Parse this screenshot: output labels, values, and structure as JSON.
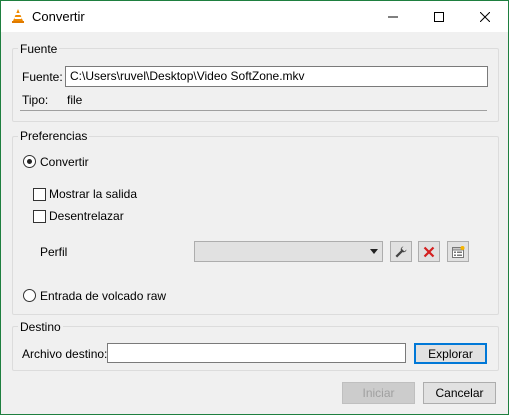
{
  "window": {
    "title": "Convertir"
  },
  "fuente": {
    "group_label": "Fuente",
    "fuente_label": "Fuente:",
    "fuente_value": "C:\\Users\\ruvel\\Desktop\\Video SoftZone.mkv",
    "tipo_label": "Tipo:",
    "tipo_value": "file"
  },
  "preferencias": {
    "group_label": "Preferencias",
    "convertir_label": "Convertir",
    "convertir_selected": true,
    "mostrar_salida_label": "Mostrar la salida",
    "mostrar_salida_checked": false,
    "desentrelazar_label": "Desentrelazar",
    "desentrelazar_checked": false,
    "perfil_label": "Perfil",
    "perfil_value": "",
    "raw_label": "Entrada de volcado raw",
    "raw_selected": false
  },
  "destino": {
    "group_label": "Destino",
    "archivo_label": "Archivo destino:",
    "archivo_value": "",
    "explorar_label": "Explorar"
  },
  "footer": {
    "iniciar_label": "Iniciar",
    "cancelar_label": "Cancelar"
  }
}
